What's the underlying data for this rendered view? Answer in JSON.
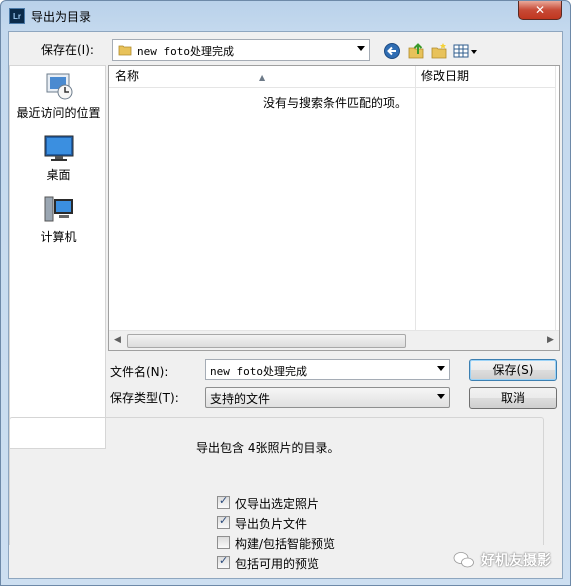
{
  "window": {
    "title": "导出为目录",
    "app_badge": "Lr",
    "close_symbol": "✕"
  },
  "lookin": {
    "label": "保存在(I):",
    "value": "new foto处理完成"
  },
  "places": [
    {
      "label": "最近访问的位置",
      "icon": "recent-places-icon"
    },
    {
      "label": "桌面",
      "icon": "desktop-icon"
    },
    {
      "label": "计算机",
      "icon": "computer-icon"
    }
  ],
  "filelist": {
    "columns": [
      "名称",
      "修改日期"
    ],
    "empty_message": "没有与搜索条件匹配的项。"
  },
  "filename": {
    "label": "文件名(N):",
    "value": "new foto处理完成"
  },
  "filetype": {
    "label": "保存类型(T):",
    "value": "支持的文件"
  },
  "buttons": {
    "save": "保存(S)",
    "cancel": "取消"
  },
  "options": {
    "message": "导出包含 4张照片的目录。",
    "checkboxes": [
      {
        "label": "仅导出选定照片",
        "checked": true
      },
      {
        "label": "导出负片文件",
        "checked": true
      },
      {
        "label": "构建/包括智能预览",
        "checked": false
      },
      {
        "label": "包括可用的预览",
        "checked": true
      }
    ]
  },
  "watermark": {
    "text": "好机友摄影"
  }
}
